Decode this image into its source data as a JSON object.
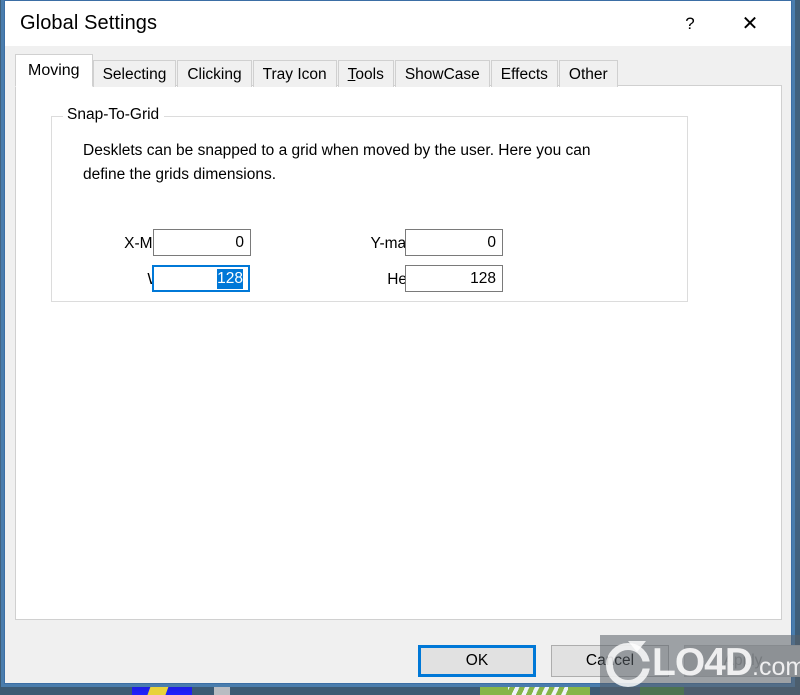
{
  "window": {
    "title": "Global Settings",
    "help_label": "?",
    "close_label": "✕"
  },
  "tabs": [
    {
      "label": "Moving",
      "active": true
    },
    {
      "label": "Selecting",
      "active": false
    },
    {
      "label": "Clicking",
      "active": false
    },
    {
      "label": "Tray Icon",
      "active": false
    },
    {
      "label": "Tools",
      "active": false,
      "mnemonic": "T"
    },
    {
      "label": "ShowCase",
      "active": false
    },
    {
      "label": "Effects",
      "active": false
    },
    {
      "label": "Other",
      "active": false
    }
  ],
  "group": {
    "legend": "Snap-To-Grid",
    "description": "Desklets can be snapped to a grid when moved by the user. Here you can define the grids dimensions."
  },
  "fields": {
    "x_margin": {
      "label": "X-Margin",
      "value": "0",
      "focused": false
    },
    "y_margin": {
      "label": "Y-margin",
      "value": "0",
      "focused": false
    },
    "width": {
      "label": "Width",
      "value": "128",
      "focused": true,
      "selected": true
    },
    "height": {
      "label": "Height",
      "value": "128",
      "focused": false
    }
  },
  "buttons": {
    "ok": {
      "label": "OK",
      "default": true,
      "disabled": false
    },
    "cancel": {
      "label": "Cancel",
      "default": false,
      "disabled": false
    },
    "apply": {
      "label": "Apply",
      "default": false,
      "disabled": true
    }
  },
  "watermark": {
    "brand": "LO4D",
    "suffix": ".com"
  },
  "colors": {
    "accent": "#0078d7",
    "window_border": "#3b6ea5",
    "dialog_face": "#f0f0f0",
    "panel": "#ffffff",
    "selection": "#0078d7",
    "disabled_text": "#9a9a9a"
  }
}
